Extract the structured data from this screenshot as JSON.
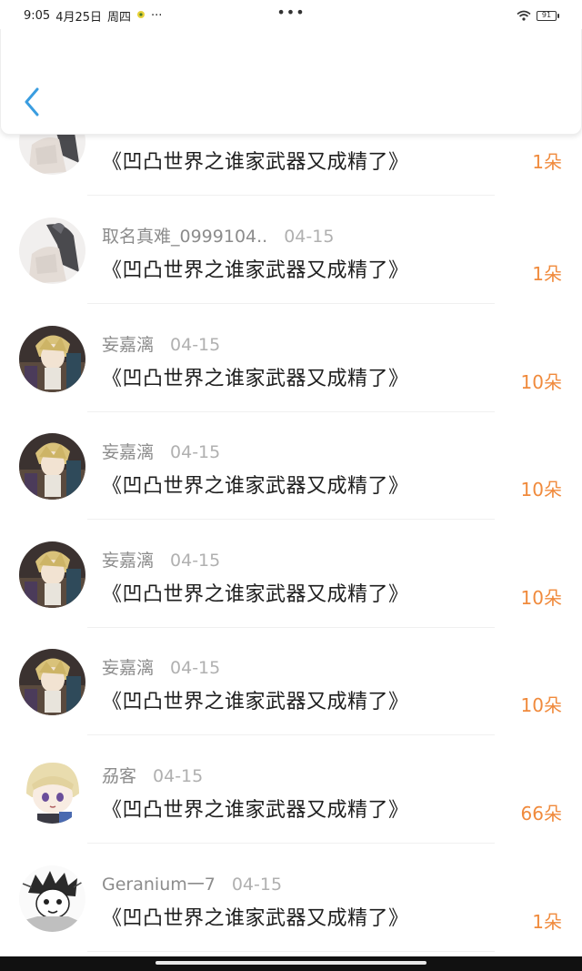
{
  "status_bar": {
    "time": "9:05",
    "date": "4月25日",
    "weekday": "周四",
    "more": "···",
    "center_dots": "•••",
    "battery": "91"
  },
  "header": {
    "back_icon": "chevron-left-icon",
    "accent": "#3a9de0"
  },
  "items": [
    {
      "name": "",
      "date": "",
      "title": "《凹凸世界之谁家武器又成精了》",
      "gift": "1朵",
      "avatar": "gray-hair-avatar"
    },
    {
      "name": "取名真难_0999104..",
      "date": "04-15",
      "title": "《凹凸世界之谁家武器又成精了》",
      "gift": "1朵",
      "avatar": "gray-hair-avatar"
    },
    {
      "name": "妄嘉漓",
      "date": "04-15",
      "title": "《凹凸世界之谁家武器又成精了》",
      "gift": "10朵",
      "avatar": "blonde-character-avatar"
    },
    {
      "name": "妄嘉漓",
      "date": "04-15",
      "title": "《凹凸世界之谁家武器又成精了》",
      "gift": "10朵",
      "avatar": "blonde-character-avatar"
    },
    {
      "name": "妄嘉漓",
      "date": "04-15",
      "title": "《凹凸世界之谁家武器又成精了》",
      "gift": "10朵",
      "avatar": "blonde-character-avatar"
    },
    {
      "name": "妄嘉漓",
      "date": "04-15",
      "title": "《凹凸世界之谁家武器又成精了》",
      "gift": "10朵",
      "avatar": "blonde-character-avatar"
    },
    {
      "name": "刕客",
      "date": "04-15",
      "title": "《凹凸世界之谁家武器又成精了》",
      "gift": "66朵",
      "avatar": "chibi-blonde-avatar"
    },
    {
      "name": "Geranium一7",
      "date": "04-15",
      "title": "《凹凸世界之谁家武器又成精了》",
      "gift": "1朵",
      "avatar": "sketch-character-avatar"
    }
  ],
  "colors": {
    "gift": "#f08a3c",
    "name": "#8c8c8c",
    "date": "#b0b0b0"
  }
}
